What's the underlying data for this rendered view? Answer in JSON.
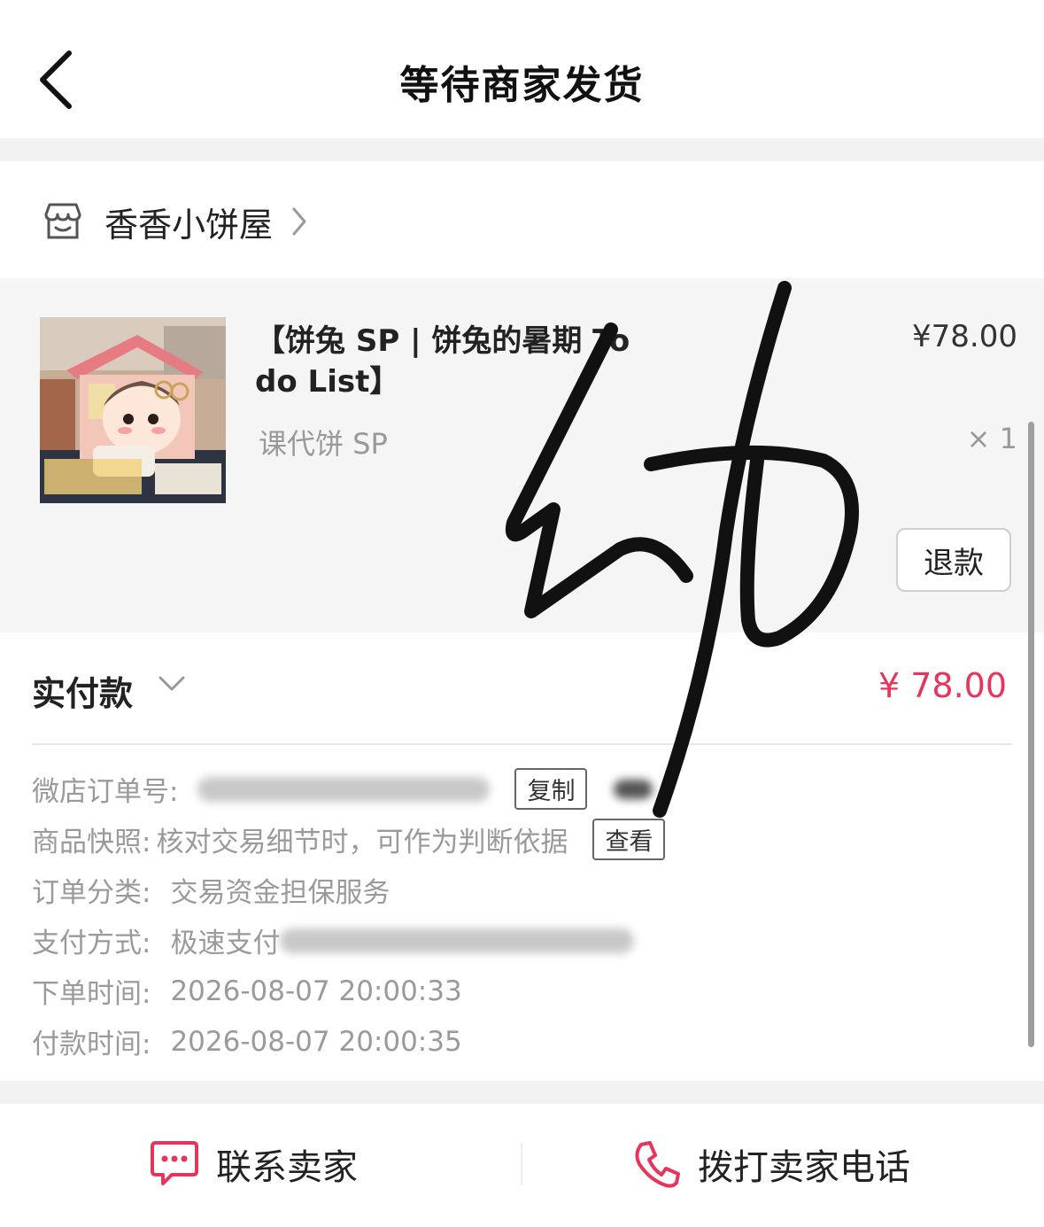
{
  "header": {
    "title": "等待商家发货"
  },
  "shop": {
    "name": "香香小饼屋"
  },
  "item": {
    "name": "【饼兔 SP | 饼兔的暑期 To do List】",
    "spec": "课代饼 SP",
    "price": "¥78.00",
    "quantity": "× 1",
    "refund_label": "退款"
  },
  "payment": {
    "label": "实付款",
    "amount": "¥ 78.00"
  },
  "info": {
    "order_no_label": "微店订单号:",
    "copy_label": "复制",
    "snapshot_label": "商品快照:",
    "snapshot_value": "核对交易细节时，可作为判断依据",
    "view_label": "查看",
    "category_label": "订单分类:",
    "category_value": "交易资金担保服务",
    "method_label": "支付方式:",
    "method_value": "极速支付",
    "order_time_label": "下单时间:",
    "order_time_value": "2026-08-07 20:00:33",
    "pay_time_label": "付款时间:",
    "pay_time_value": "2026-08-07 20:00:35"
  },
  "actions": {
    "contact_label": "联系卖家",
    "call_label": "拨打卖家电话"
  },
  "colors": {
    "price_red": "#e8335a",
    "icon_red": "#e8335a"
  },
  "icons": [
    "back-arrow-icon",
    "shop-icon",
    "chevron-right-icon",
    "chevron-down-icon",
    "chat-icon",
    "phone-icon"
  ]
}
